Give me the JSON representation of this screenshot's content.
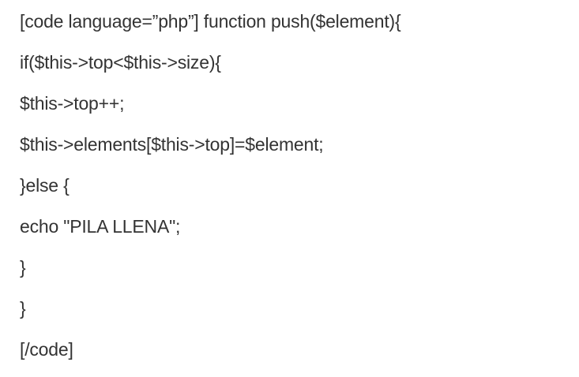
{
  "code_block": {
    "lines": [
      "[code language=”php”] function push($element){",
      "if($this->top<$this->size){",
      "$this->top++;",
      "$this->elements[$this->top]=$element;",
      "}else {",
      "echo \"PILA LLENA\";",
      "}",
      "}",
      "[/code]"
    ]
  }
}
